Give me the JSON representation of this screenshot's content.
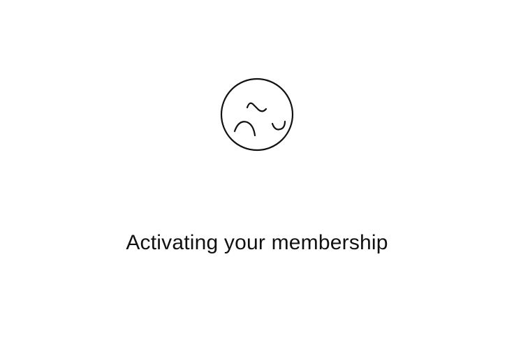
{
  "loading": {
    "icon": "membership-logo-icon",
    "message": "Activating your membership"
  },
  "colors": {
    "background": "#ffffff",
    "foreground": "#111111"
  }
}
